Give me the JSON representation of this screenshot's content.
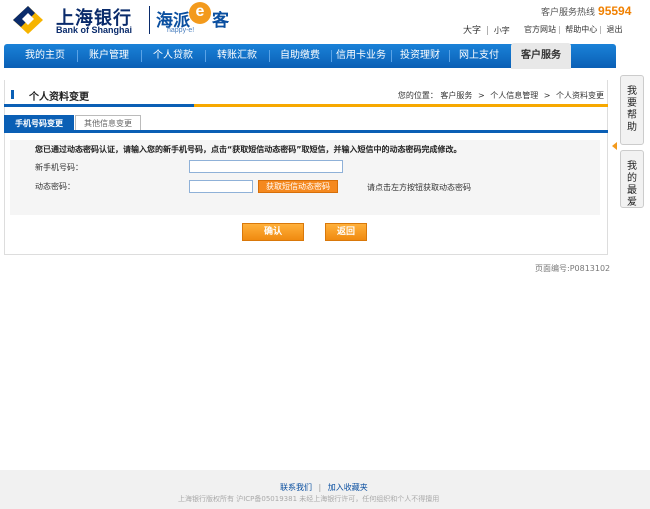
{
  "header": {
    "logo_cn": "上海银行",
    "logo_en": "Bank of Shanghai",
    "brand_cn": "海派",
    "brand_mark": "e",
    "brand_tail": "客",
    "brand_en": "happy-e!",
    "hotline_label": "客户服务热线",
    "hotline_number": "95594",
    "font_large": "大字",
    "font_small": "小字",
    "links": [
      "官方网站",
      "帮助中心",
      "退出"
    ]
  },
  "nav": {
    "items": [
      "我的主页",
      "账户管理",
      "个人贷款",
      "转账汇款",
      "自助缴费",
      "信用卡业务",
      "投资理财",
      "网上支付",
      "客户服务"
    ],
    "active_index": 8
  },
  "page": {
    "title": "个人资料变更",
    "crumb_label": "您的位置：",
    "crumb": [
      "客户服务",
      "个人信息管理",
      "个人资料变更"
    ]
  },
  "tabs": [
    "手机号码变更",
    "其他信息变更"
  ],
  "form": {
    "notice": "您已通过动态密码认证，请输入您的新手机号码，点击“获取短信动态密码”取短信，并输入短信中的动态密码完成修改。",
    "phone_label": "新手机号码：",
    "otp_label": "动态密码：",
    "sms_button": "获取短信动态密码",
    "hint": "请点击左方按钮获取动态密码",
    "confirm": "确认",
    "back": "返回"
  },
  "page_id": "页面编号:P0813102",
  "side": {
    "help": "我要帮助",
    "fav": "我的最爱"
  },
  "footer": {
    "contact": "联系我们",
    "bookmark": "加入收藏夹",
    "copyright": "上海银行版权所有 沪ICP备05019381 未经上海银行许可，任何组织和个人不得擅用"
  },
  "colors": {
    "nav_blue": "#0a5fb5",
    "accent_orange": "#f39a1c",
    "hotline": "#f08000"
  }
}
